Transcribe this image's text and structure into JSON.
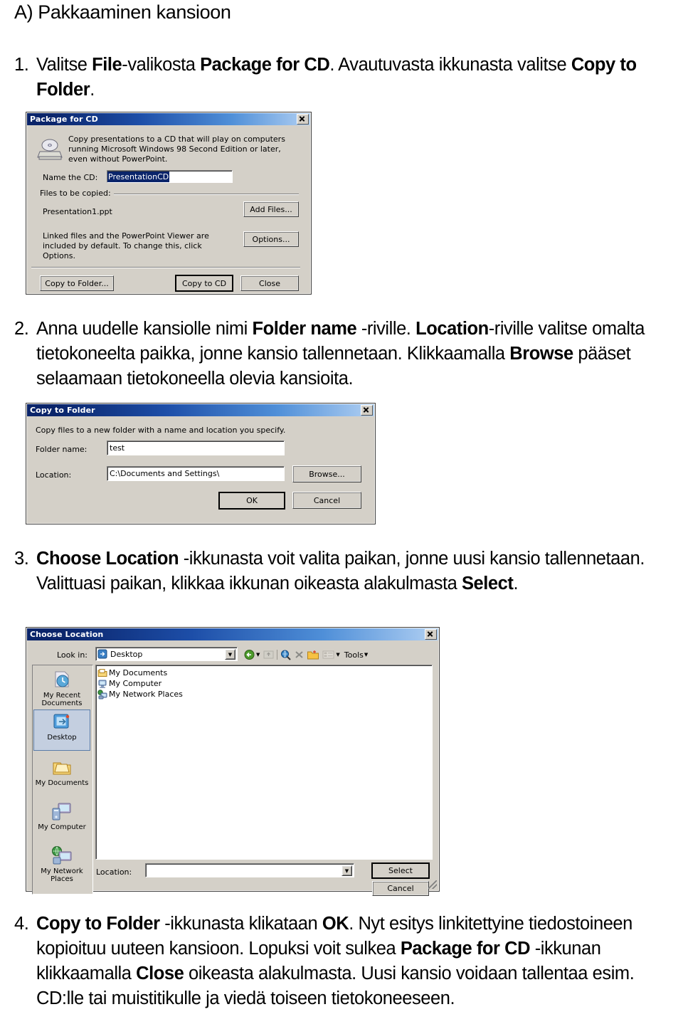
{
  "document": {
    "title": "A) Pakkaaminen kansioon",
    "steps": [
      {
        "number": "1.",
        "segments": [
          {
            "text": "Valitse ",
            "bold": false
          },
          {
            "text": "File",
            "bold": true
          },
          {
            "text": "-valikosta ",
            "bold": false
          },
          {
            "text": "Package for CD",
            "bold": true
          },
          {
            "text": ". Avautuvasta ikkunasta valitse ",
            "bold": false
          },
          {
            "text": "Copy to Folder",
            "bold": true
          },
          {
            "text": ".",
            "bold": false
          }
        ]
      },
      {
        "number": "2.",
        "segments": [
          {
            "text": "Anna uudelle kansiolle nimi ",
            "bold": false
          },
          {
            "text": "Folder name",
            "bold": true
          },
          {
            "text": " -riville. ",
            "bold": false
          },
          {
            "text": "Location",
            "bold": true
          },
          {
            "text": "-riville valitse omalta tietokoneelta paikka, jonne kansio tallennetaan. Klikkaamalla ",
            "bold": false
          },
          {
            "text": "Browse",
            "bold": true
          },
          {
            "text": " pääset selaamaan tietokoneella olevia kansioita.",
            "bold": false
          }
        ]
      },
      {
        "number": "3.",
        "segments": [
          {
            "text": "Choose Location",
            "bold": true
          },
          {
            "text": " -ikkunasta voit valita paikan, jonne uusi kansio tallennetaan. Valittuasi paikan, klikkaa ikkunan oikeasta alakulmasta ",
            "bold": false
          },
          {
            "text": "Select",
            "bold": true
          },
          {
            "text": ".",
            "bold": false
          }
        ]
      },
      {
        "number": "4.",
        "segments": [
          {
            "text": "Copy to Folder",
            "bold": true
          },
          {
            "text": " -ikkunasta klikataan ",
            "bold": false
          },
          {
            "text": "OK",
            "bold": true
          },
          {
            "text": ". Nyt esitys linkitettyine tiedostoineen kopioituu uuteen kansioon. Lopuksi voit sulkea ",
            "bold": false
          },
          {
            "text": "Package for CD",
            "bold": true
          },
          {
            "text": " -ikkunan klikkaamalla ",
            "bold": false
          },
          {
            "text": "Close",
            "bold": true
          },
          {
            "text": " oikeasta alakulmasta. Uusi kansio voidaan tallentaa esim. CD:lle tai muistitikulle ja viedä toiseen tietokoneeseen.",
            "bold": false
          }
        ]
      }
    ]
  },
  "dialog_package_for_cd": {
    "title": "Package for CD",
    "close_label": "✕",
    "description": "Copy presentations to a CD that will play on computers running Microsoft Windows 98 Second Edition or later, even without PowerPoint.",
    "name_label": "Name the CD:",
    "name_value": "PresentationCD",
    "files_group_label": "Files to be copied:",
    "file_item": "Presentation1.ppt",
    "add_files_label": "Add Files...",
    "linked_note": "Linked files and the PowerPoint Viewer are included by default. To change this, click Options.",
    "options_label": "Options...",
    "copy_to_folder_label": "Copy to Folder...",
    "copy_to_cd_label": "Copy to CD",
    "close_button_label": "Close"
  },
  "dialog_copy_to_folder": {
    "title": "Copy to Folder",
    "close_label": "✕",
    "description": "Copy files to a new folder with a name and location you specify.",
    "folder_name_label": "Folder name:",
    "folder_name_value": "test",
    "location_label": "Location:",
    "location_value": "C:\\Documents and Settings\\",
    "browse_label": "Browse...",
    "ok_label": "OK",
    "cancel_label": "Cancel"
  },
  "dialog_choose_location": {
    "title": "Choose Location",
    "close_label": "✕",
    "look_in_label": "Look in:",
    "look_in_value": "Desktop",
    "toolbar": {
      "back_label": "Back",
      "up_label": "Up One Level",
      "search_label": "Search the Web",
      "delete_label": "Delete",
      "new_folder_label": "Create New Folder",
      "views_label": "Views",
      "tools_label": "Tools"
    },
    "places": [
      {
        "label": "My Recent Documents",
        "icon": "recent-documents-icon",
        "selected": false
      },
      {
        "label": "Desktop",
        "icon": "desktop-icon",
        "selected": true
      },
      {
        "label": "My Documents",
        "icon": "my-documents-icon",
        "selected": false
      },
      {
        "label": "My Computer",
        "icon": "my-computer-icon",
        "selected": false
      },
      {
        "label": "My Network Places",
        "icon": "my-network-places-icon",
        "selected": false
      }
    ],
    "files": [
      {
        "label": "My Documents",
        "icon": "folder-icon"
      },
      {
        "label": "My Computer",
        "icon": "computer-icon"
      },
      {
        "label": "My Network Places",
        "icon": "network-icon"
      }
    ],
    "location_label": "Location:",
    "location_value": "",
    "select_label": "Select",
    "cancel_label": "Cancel"
  },
  "colors": {
    "titlebar_start": "#0a246a",
    "titlebar_end": "#b6d4f2",
    "dialog_face": "#d4d0c8",
    "selection": "#0a246a",
    "sidebar_selected": "#c4cfe0"
  }
}
